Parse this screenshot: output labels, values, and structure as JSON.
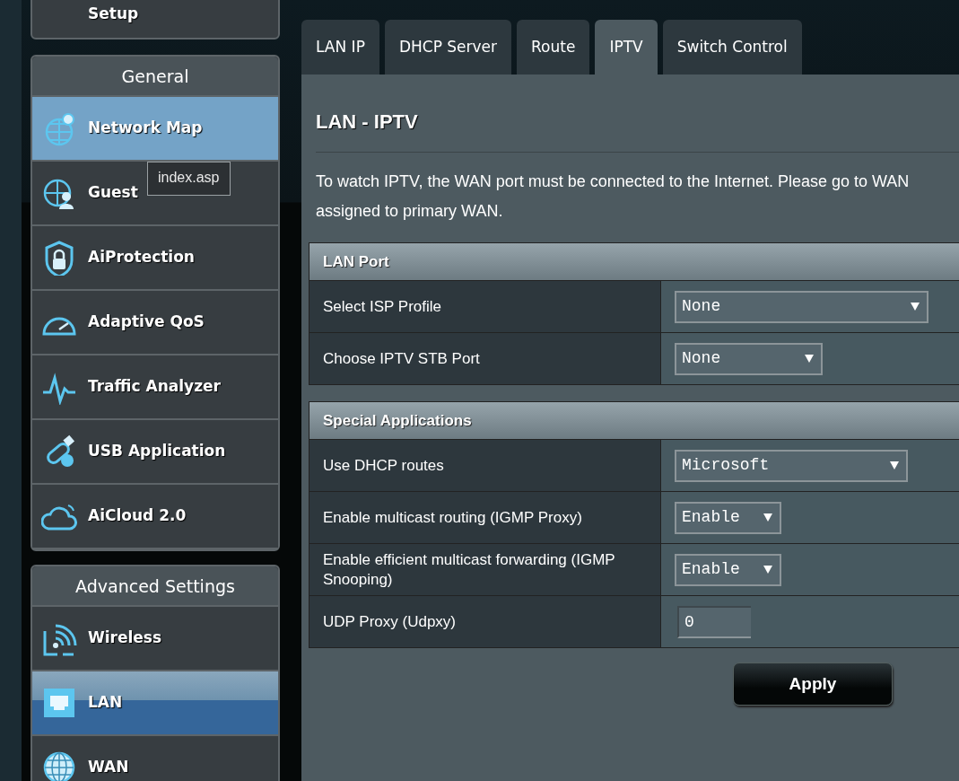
{
  "setup_box": {
    "label": "Setup"
  },
  "sidebar_groups": [
    {
      "title": "General",
      "items": [
        {
          "label": "Network Map",
          "selected": false,
          "hovered": true
        },
        {
          "label": "Guest",
          "selected": false,
          "hovered": false
        },
        {
          "label": "AiProtection",
          "selected": false,
          "hovered": false
        },
        {
          "label": "Adaptive QoS",
          "selected": false,
          "hovered": false
        },
        {
          "label": "Traffic Analyzer",
          "selected": false,
          "hovered": false
        },
        {
          "label": "USB Application",
          "selected": false,
          "hovered": false
        },
        {
          "label": "AiCloud 2.0",
          "selected": false,
          "hovered": false
        }
      ]
    },
    {
      "title": "Advanced Settings",
      "items": [
        {
          "label": "Wireless",
          "selected": false,
          "hovered": false
        },
        {
          "label": "LAN",
          "selected": true,
          "hovered": false
        },
        {
          "label": "WAN",
          "selected": false,
          "hovered": false
        }
      ]
    }
  ],
  "tooltip": {
    "text": "index.asp"
  },
  "tabs": [
    {
      "label": "LAN IP",
      "selected": false
    },
    {
      "label": "DHCP Server",
      "selected": false
    },
    {
      "label": "Route",
      "selected": false
    },
    {
      "label": "IPTV",
      "selected": true
    },
    {
      "label": "Switch Control",
      "selected": false
    }
  ],
  "page_title": "LAN - IPTV",
  "description": {
    "line_1": "To watch IPTV, the WAN port must be connected to the Internet. Please go to",
    "link": "WAN",
    "line_2": "assigned to primary WAN."
  },
  "sections": [
    {
      "title": "LAN Port",
      "rows": [
        {
          "label": "Select ISP Profile",
          "kind": "select",
          "value": "None"
        },
        {
          "label": "Choose IPTV STB Port",
          "kind": "select",
          "value": "None"
        }
      ]
    },
    {
      "title": "Special Applications",
      "rows": [
        {
          "label": "Use DHCP routes",
          "kind": "select",
          "value": "Microsoft"
        },
        {
          "label": "Enable multicast routing (IGMP Proxy)",
          "kind": "select",
          "value": "Enable"
        },
        {
          "label": "Enable efficient multicast forwarding (IGMP Snooping)",
          "kind": "select",
          "value": "Enable"
        },
        {
          "label": "UDP Proxy (Udpxy)",
          "kind": "input",
          "value": "0"
        }
      ]
    }
  ],
  "apply_button": "Apply"
}
